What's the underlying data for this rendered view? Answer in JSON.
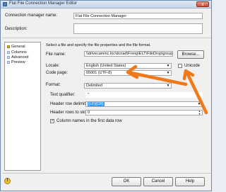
{
  "window": {
    "title": "Flat File Connection Manager Editor",
    "close_label": "x"
  },
  "connection_name": {
    "label": "Connection manager name:",
    "value": "Flat File Connection Manager"
  },
  "description": {
    "label": "Description:",
    "value": ""
  },
  "nav": {
    "items": [
      {
        "label": "General",
        "selected": true
      },
      {
        "label": "Columns",
        "selected": false
      },
      {
        "label": "Advanced",
        "selected": false
      },
      {
        "label": "Preview",
        "selected": false
      }
    ]
  },
  "general": {
    "instruction": "Select a file and specify the file properties and the file format.",
    "file_name_label": "File name:",
    "file_name_value": "\\\\drivecaminc.loc\\dcnad\\Freng\\ELT\\FileDrop\\groups_d",
    "browse_label": "Browse...",
    "locale_label": "Locale:",
    "locale_value": "English (United States)",
    "unicode_label": "Unicode",
    "code_page_label": "Code page:",
    "code_page_value": "65001 (UTF-8)",
    "format_label": "Format:",
    "format_value": "Delimited",
    "text_qualifier_label": "Text qualifier:",
    "text_qualifier_value": "\"",
    "header_delim_label": "Header row delimiter:",
    "header_delim_value": "{LF}{CR}",
    "header_skip_label": "Header rows to skip:",
    "header_skip_value": "0",
    "column_names_label": "Column names in the first data row"
  },
  "buttons": {
    "ok": "OK",
    "cancel": "Cancel",
    "help": "Help"
  },
  "colors": {
    "annotation_arrow": "#f07a1a",
    "highlight": "#3399ff"
  }
}
